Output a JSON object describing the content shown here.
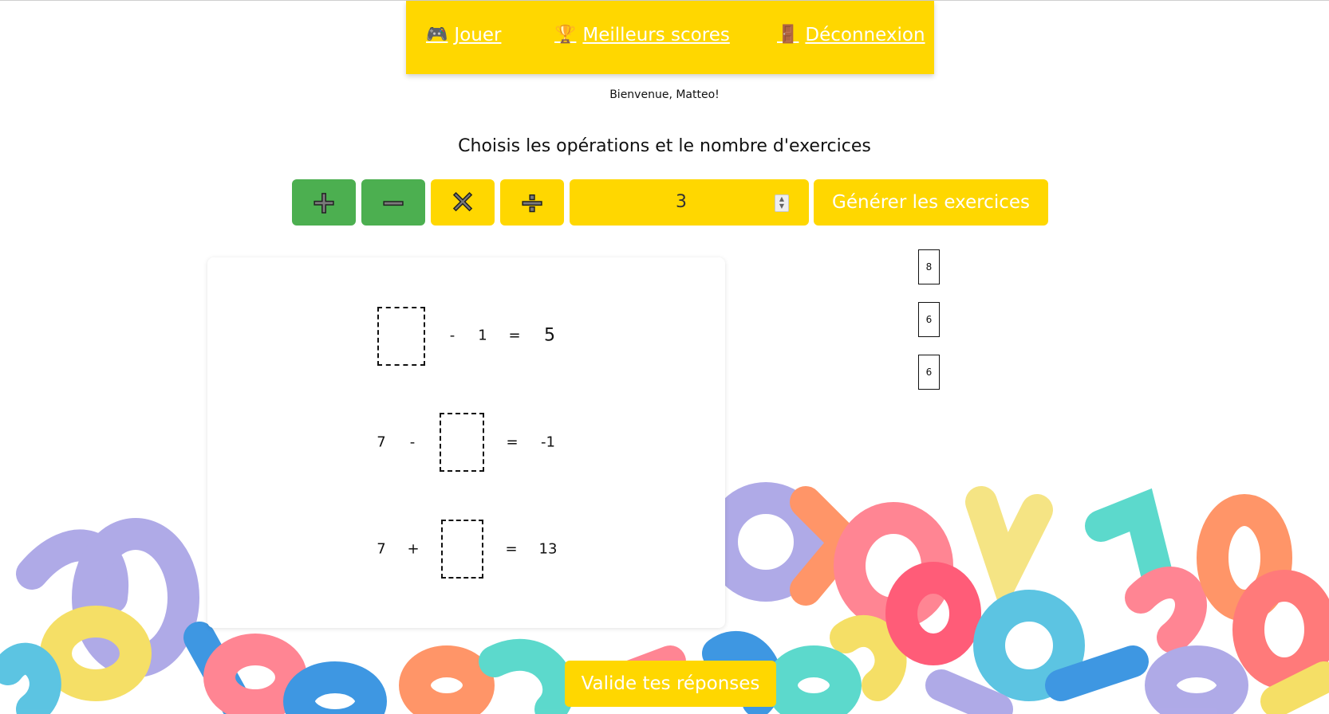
{
  "nav": {
    "items": [
      {
        "icon": "game-controller-icon",
        "glyph": "🎮",
        "label": "Jouer"
      },
      {
        "icon": "trophy-icon",
        "glyph": "🏆",
        "label": "Meilleurs scores"
      },
      {
        "icon": "door-icon",
        "glyph": "🚪",
        "label": "Déconnexion"
      }
    ]
  },
  "welcome": "Bienvenue, Matteo!",
  "heading": "Choisis les opérations et le nombre d'exercices",
  "operations": [
    {
      "name": "addition",
      "symbol": "+",
      "selected": true
    },
    {
      "name": "subtraction",
      "symbol": "−",
      "selected": true
    },
    {
      "name": "multiplication",
      "symbol": "✕",
      "selected": false
    },
    {
      "name": "division",
      "symbol": "÷",
      "selected": false
    }
  ],
  "exercise_count": {
    "value": "3"
  },
  "generate_label": "Générer les exercices",
  "exercises": [
    {
      "a": "",
      "op": "-",
      "b": "1",
      "eq": "=",
      "result": "5",
      "blank": "a"
    },
    {
      "a": "7",
      "op": "-",
      "b": "",
      "eq": "=",
      "result": "-1",
      "blank": "b"
    },
    {
      "a": "7",
      "op": "+",
      "b": "",
      "eq": "=",
      "result": "13",
      "blank": "b"
    }
  ],
  "answer_tiles": [
    "8",
    "6",
    "6"
  ],
  "submit_label": "Valide tes réponses",
  "colors": {
    "accent": "#ffd700",
    "selected": "#4caf50",
    "text": "#111111"
  }
}
